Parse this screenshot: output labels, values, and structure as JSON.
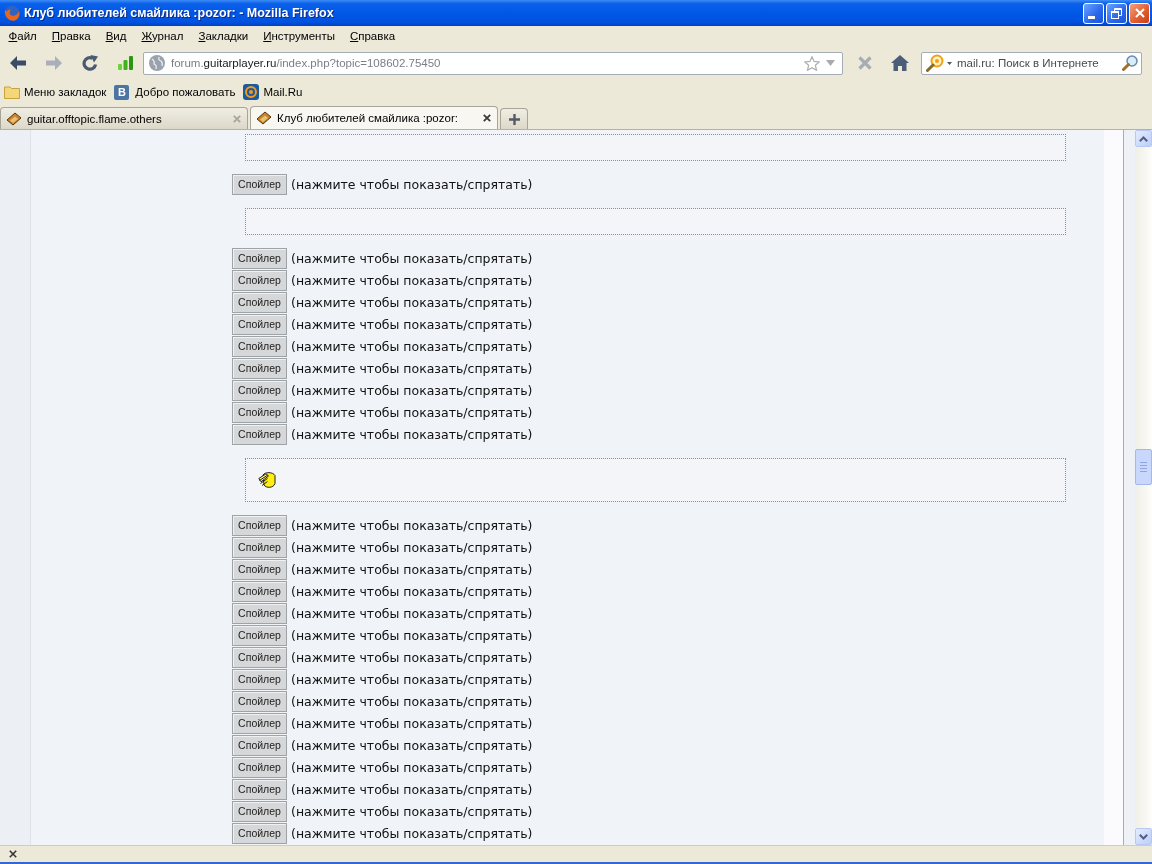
{
  "window": {
    "title": "Клуб любителей смайлика :pozor: - Mozilla Firefox"
  },
  "menu_bar": [
    "Файл",
    "Правка",
    "Вид",
    "Журнал",
    "Закладки",
    "Инструменты",
    "Справка"
  ],
  "nav_bar": {
    "back": {
      "disabled": false
    },
    "forward": {
      "disabled": true
    },
    "reload": {
      "disabled": false
    },
    "address": {
      "subdomain": "forum.",
      "domain": "guitarplayer.ru",
      "path": "/index.php?topic=108602.75450"
    },
    "stop": {
      "disabled": true
    },
    "home": {
      "disabled": false
    },
    "search": {
      "placeholder": "mail.ru: Поиск в Интернете"
    }
  },
  "bookmarks_bar": [
    {
      "kind": "folder",
      "label": "Меню закладок"
    },
    {
      "kind": "letter",
      "icon_text": "В",
      "label": "Добро пожаловать"
    },
    {
      "kind": "mail",
      "label": "Mail.Ru"
    }
  ],
  "tabs": [
    {
      "label": "guitar.offtopic.flame.others",
      "selected": false
    },
    {
      "label": "Клуб любителей смайлика :pozor:",
      "selected": true
    }
  ],
  "content": {
    "blocks": [
      {
        "kind": "quote",
        "smiley": false
      },
      {
        "kind": "spoiler",
        "button": "Спойлер",
        "hint": "(нажмите чтобы показать/спрятать)"
      },
      {
        "kind": "quote",
        "smiley": false
      },
      {
        "kind": "spoiler",
        "button": "Спойлер",
        "hint": "(нажмите чтобы показать/спрятать)"
      },
      {
        "kind": "spoiler",
        "button": "Спойлер",
        "hint": "(нажмите чтобы показать/спрятать)"
      },
      {
        "kind": "spoiler",
        "button": "Спойлер",
        "hint": "(нажмите чтобы показать/спрятать)"
      },
      {
        "kind": "spoiler",
        "button": "Спойлер",
        "hint": "(нажмите чтобы показать/спрятать)"
      },
      {
        "kind": "spoiler",
        "button": "Спойлер",
        "hint": "(нажмите чтобы показать/спрятать)"
      },
      {
        "kind": "spoiler",
        "button": "Спойлер",
        "hint": "(нажмите чтобы показать/спрятать)"
      },
      {
        "kind": "spoiler",
        "button": "Спойлер",
        "hint": "(нажмите чтобы показать/спрятать)"
      },
      {
        "kind": "spoiler",
        "button": "Спойлер",
        "hint": "(нажмите чтобы показать/спрятать)"
      },
      {
        "kind": "spoiler",
        "button": "Спойлер",
        "hint": "(нажмите чтобы показать/спрятать)"
      },
      {
        "kind": "quote",
        "smiley": true
      },
      {
        "kind": "spoiler",
        "button": "Спойлер",
        "hint": "(нажмите чтобы показать/спрятать)"
      },
      {
        "kind": "spoiler",
        "button": "Спойлер",
        "hint": "(нажмите чтобы показать/спрятать)"
      },
      {
        "kind": "spoiler",
        "button": "Спойлер",
        "hint": "(нажмите чтобы показать/спрятать)"
      },
      {
        "kind": "spoiler",
        "button": "Спойлер",
        "hint": "(нажмите чтобы показать/спрятать)"
      },
      {
        "kind": "spoiler",
        "button": "Спойлер",
        "hint": "(нажмите чтобы показать/спрятать)"
      },
      {
        "kind": "spoiler",
        "button": "Спойлер",
        "hint": "(нажмите чтобы показать/спрятать)"
      },
      {
        "kind": "spoiler",
        "button": "Спойлер",
        "hint": "(нажмите чтобы показать/спрятать)"
      },
      {
        "kind": "spoiler",
        "button": "Спойлер",
        "hint": "(нажмите чтобы показать/спрятать)"
      },
      {
        "kind": "spoiler",
        "button": "Спойлер",
        "hint": "(нажмите чтобы показать/спрятать)"
      },
      {
        "kind": "spoiler",
        "button": "Спойлер",
        "hint": "(нажмите чтобы показать/спрятать)"
      },
      {
        "kind": "spoiler",
        "button": "Спойлер",
        "hint": "(нажмите чтобы показать/спрятать)"
      },
      {
        "kind": "spoiler",
        "button": "Спойлер",
        "hint": "(нажмите чтобы показать/спрятать)"
      },
      {
        "kind": "spoiler",
        "button": "Спойлер",
        "hint": "(нажмите чтобы показать/спрятать)"
      },
      {
        "kind": "spoiler",
        "button": "Спойлер",
        "hint": "(нажмите чтобы показать/спрятать)"
      },
      {
        "kind": "spoiler",
        "button": "Спойлер",
        "hint": "(нажмите чтобы показать/спрятать)"
      }
    ]
  }
}
